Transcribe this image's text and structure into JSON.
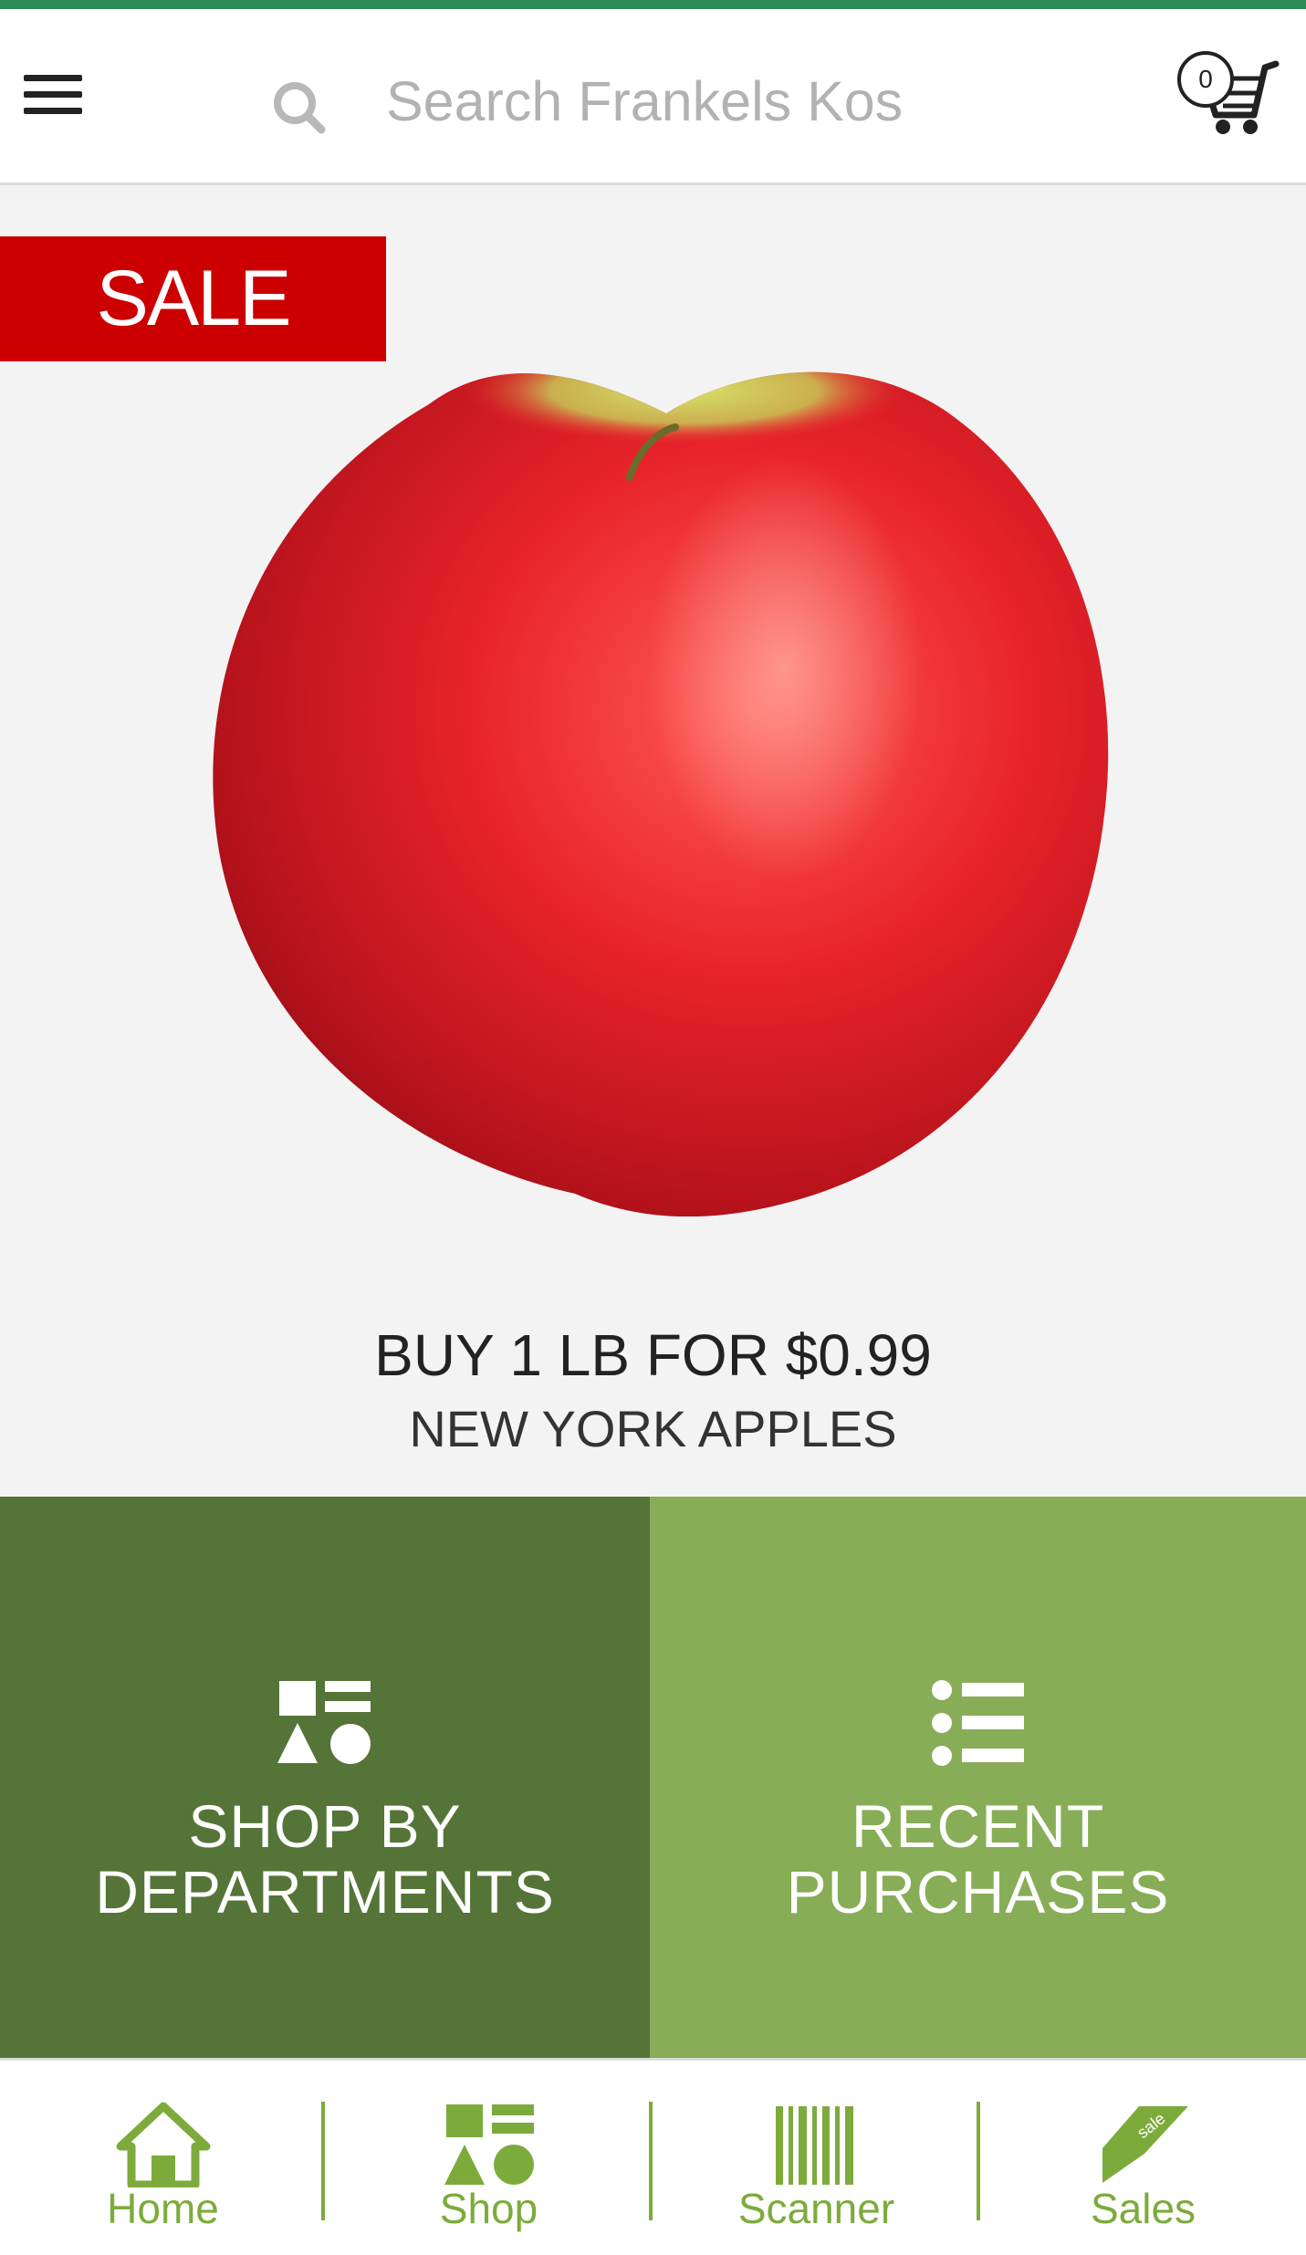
{
  "header": {
    "search_placeholder": "Search Frankels Kos",
    "cart_count": "0"
  },
  "hero": {
    "badge": "SALE",
    "promo_title": "BUY 1 LB FOR $0.99",
    "promo_subtitle": "NEW YORK APPLES"
  },
  "tiles": [
    {
      "line1": "SHOP BY",
      "line2": "DEPARTMENTS",
      "icon": "departments-shapes-icon"
    },
    {
      "line1": "RECENT",
      "line2": "PURCHASES",
      "icon": "list-icon"
    }
  ],
  "bottom_nav": [
    {
      "label": "Home",
      "icon": "home-icon"
    },
    {
      "label": "Shop",
      "icon": "shapes-icon"
    },
    {
      "label": "Scanner",
      "icon": "barcode-icon"
    },
    {
      "label": "Sales",
      "icon": "sale-tag-icon",
      "icon_text": "sale"
    }
  ],
  "colors": {
    "top_accent": "#2e8b57",
    "sale_red": "#cc0000",
    "dark_green": "#557437",
    "light_green": "#87ad56",
    "nav_green": "#7cab3c"
  }
}
